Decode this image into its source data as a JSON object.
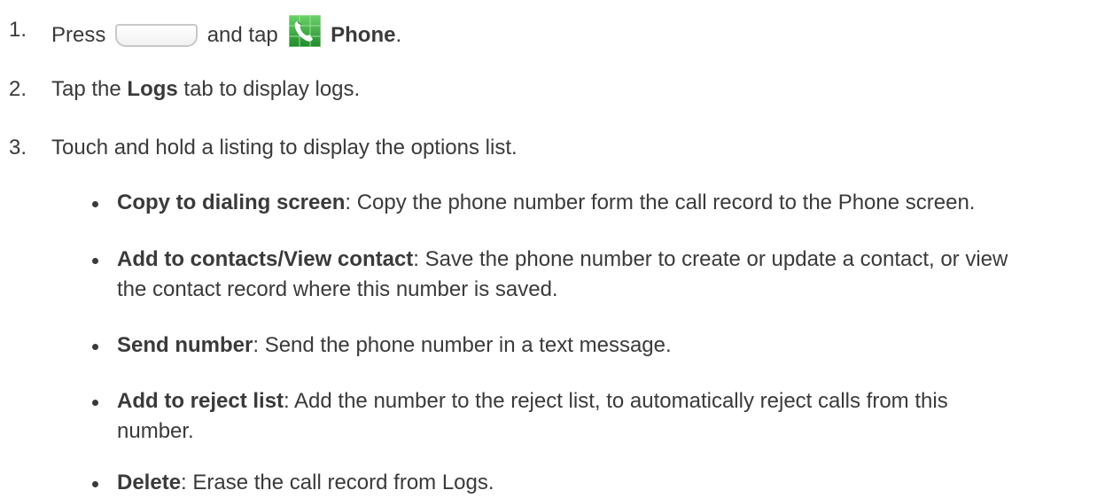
{
  "steps": [
    {
      "number": "1.",
      "pre": "Press",
      "mid": "and tap",
      "bold": "Phone",
      "post": "."
    },
    {
      "number": "2.",
      "pre": "Tap the",
      "bold": "Logs",
      "post": "tab to display logs."
    },
    {
      "number": "3.",
      "text": "Touch and hold a listing to display the options list."
    }
  ],
  "options": [
    {
      "term": "Copy to dialing screen",
      "desc": ": Copy the phone number form the call record to the Phone screen."
    },
    {
      "term": "Add to contacts/View contact",
      "desc": ": Save the phone number to create or update a contact, or view the contact record where this number is saved."
    },
    {
      "term": "Send number",
      "desc": ": Send the phone number in a text message."
    },
    {
      "term": "Add to reject list",
      "desc": ": Add the number to the reject list, to automatically reject calls from this number."
    },
    {
      "term": "Delete",
      "desc": ": Erase the call record from Logs."
    }
  ],
  "icons": {
    "home_key": "home-key-icon",
    "phone": "phone-icon"
  },
  "colors": {
    "text": "#3a3a3a",
    "phone_icon_green": "#2e9e3a"
  }
}
